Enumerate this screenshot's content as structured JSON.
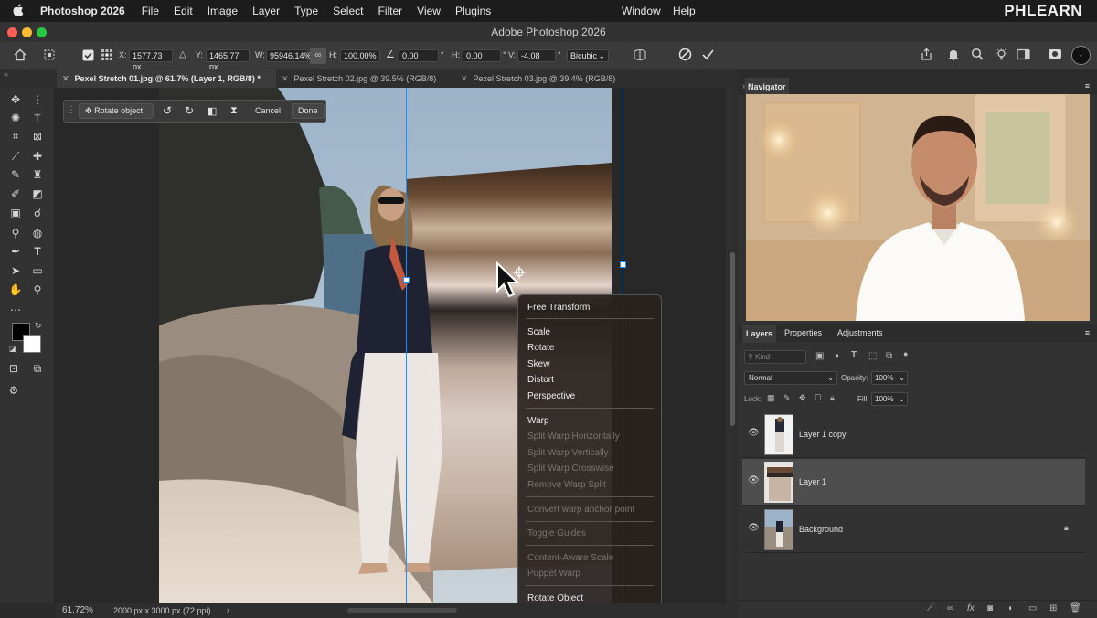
{
  "menubar": {
    "app": "Photoshop 2026",
    "items": [
      "File",
      "Edit",
      "Image",
      "Layer",
      "Type",
      "Select",
      "Filter",
      "View",
      "Plugins"
    ],
    "right_items": [
      "Window",
      "Help"
    ],
    "logo": "PHLEARN"
  },
  "window": {
    "title": "Adobe Photoshop 2026"
  },
  "options": {
    "x_label": "X:",
    "x_value": "1577.73 px",
    "y_label": "Y:",
    "y_value": "1465.77 px",
    "w_label": "W:",
    "w_value": "95946.14%",
    "h_label": "H:",
    "h_value": "100.00%",
    "angle_value": "0.00",
    "angle_unit": "°",
    "hskew_label": "H:",
    "hskew_value": "0.00",
    "hskew_unit": "°",
    "vskew_label": "V:",
    "vskew_value": "-4.08",
    "vskew_unit": "°",
    "interpolation": "Bicubic"
  },
  "tabs": [
    {
      "label": "Pexel Stretch 01.jpg @ 61.7% (Layer 1, RGB/8) *"
    },
    {
      "label": "Pexel Stretch 02.jpg @ 39.5% (RGB/8)"
    },
    {
      "label": "Pexel Stretch 03.jpg @ 39.4% (RGB/8)"
    }
  ],
  "contextbar": {
    "rotate_object": "Rotate object",
    "cancel": "Cancel",
    "done": "Done"
  },
  "contextmenu": {
    "free_transform": "Free Transform",
    "scale": "Scale",
    "rotate": "Rotate",
    "skew": "Skew",
    "distort": "Distort",
    "perspective": "Perspective",
    "warp": "Warp",
    "split_warp_h": "Split Warp Horizontally",
    "split_warp_v": "Split Warp Vertically",
    "split_warp_c": "Split Warp Crosswise",
    "remove_warp_split": "Remove Warp Split",
    "convert_warp_anchor": "Convert warp anchor point",
    "toggle_guides": "Toggle Guides",
    "content_aware_scale": "Content-Aware Scale",
    "puppet_warp": "Puppet Warp",
    "rotate_object": "Rotate Object"
  },
  "status": {
    "zoom": "61.72%",
    "doc_info": "2000 px x 3000 px (72 ppi)"
  },
  "navigator": {
    "title": "Navigator"
  },
  "layers_panel": {
    "tabs": [
      "Layers",
      "Properties",
      "Adjustments"
    ],
    "filter_placeholder": "Kind",
    "blend_mode": "Normal",
    "opacity_label": "Opacity:",
    "opacity_value": "100%",
    "lock_label": "Lock:",
    "fill_label": "Fill:",
    "fill_value": "100%",
    "layers": [
      {
        "name": "Layer 1 copy"
      },
      {
        "name": "Layer 1"
      },
      {
        "name": "Background"
      }
    ]
  },
  "colors": {
    "accent": "#1f8fff",
    "panel_bg": "#323232",
    "selected_layer": "#4e4e4e"
  }
}
